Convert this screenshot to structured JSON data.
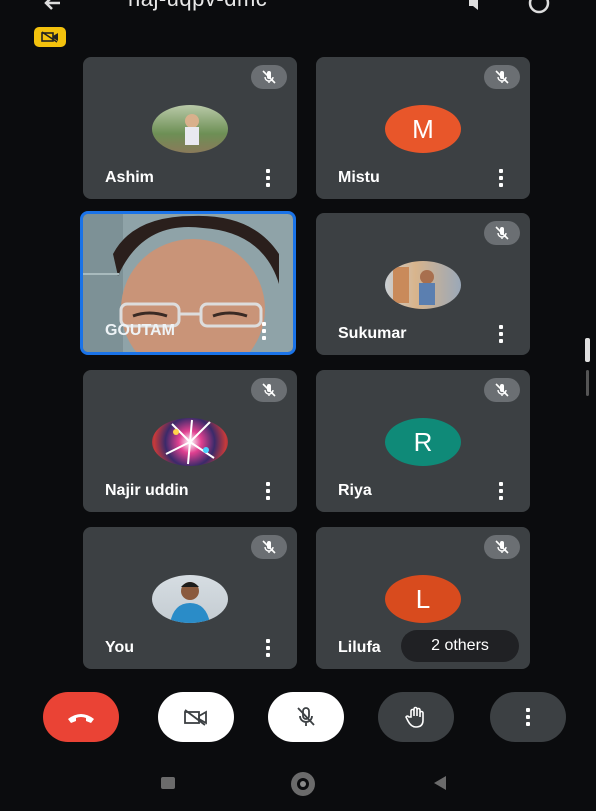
{
  "header": {
    "title": "naj-uqpv-dmc"
  },
  "participants": [
    {
      "name": "Ashim",
      "avatar": "photo-garden",
      "muted": true
    },
    {
      "name": "Mistu",
      "avatar_letter": "M",
      "avatar_color": "#e8562a",
      "muted": true
    },
    {
      "name": "GOUTAM",
      "avatar": "live-video",
      "muted": false,
      "active_speaker": true
    },
    {
      "name": "Sukumar",
      "avatar": "photo-indoor",
      "muted": true
    },
    {
      "name": "Najir uddin",
      "avatar": "photo-fireworks",
      "muted": true
    },
    {
      "name": "Riya",
      "avatar_letter": "R",
      "avatar_color": "#0f8a78",
      "muted": true
    },
    {
      "name": "You",
      "avatar": "photo-portrait",
      "muted": true
    },
    {
      "name": "Lilufa",
      "avatar_letter": "L",
      "avatar_color": "#d84b1e",
      "muted": true
    }
  ],
  "others_chip": "2 others",
  "controls": [
    {
      "icon": "end-call-icon",
      "color": "#ea4335"
    },
    {
      "icon": "camera-off-icon",
      "color": "#ffffff"
    },
    {
      "icon": "mic-off-icon",
      "color": "#ffffff"
    },
    {
      "icon": "raise-hand-icon",
      "color": "#3c4043"
    },
    {
      "icon": "more-options-icon",
      "color": "#3c4043"
    }
  ],
  "colors": {
    "tile_bg": "#3c4043",
    "active_border": "#1a73e8",
    "recording_badge": "#f4c20d"
  }
}
